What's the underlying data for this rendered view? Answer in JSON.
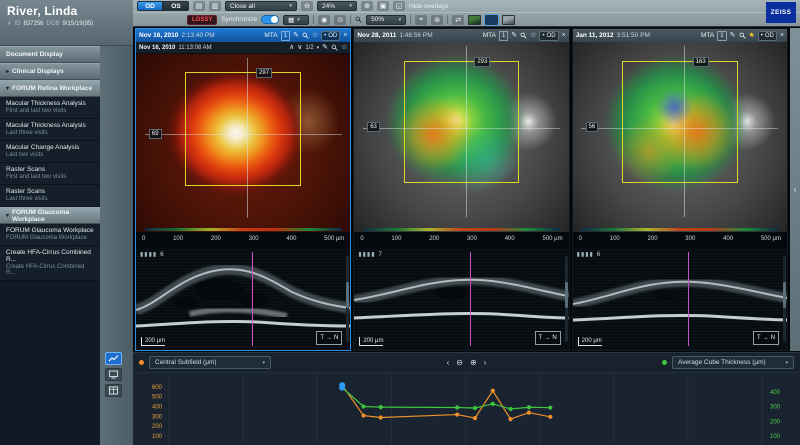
{
  "icons": {
    "pencil": "✎",
    "star": "☆",
    "star_filled": "★",
    "close": "×",
    "bullet": "•",
    "caret": "▾",
    "caret_right": "▸",
    "up": "∧",
    "down": "∨",
    "back": "‹",
    "forward": "›",
    "zoom_out": "⊖",
    "zoom_in": "⊕",
    "grid": "▦",
    "print": "▤",
    "export": "▥",
    "frame": "▣",
    "corner": "◱",
    "target": "⌖",
    "circle": "◉",
    "ring": "⊚",
    "dot_op": "⊙",
    "swap": "⇄",
    "female": "♀",
    "collapse": "‹",
    "slider": "▮▮▮▮",
    "arrow_right": "→"
  },
  "patient": {
    "name": "River, Linda",
    "sex_symbol": "♀",
    "id_label": "ID",
    "id": "837256",
    "dob_label": "DOB",
    "dob": "9/15/19(95)"
  },
  "sidebar": {
    "items": [
      {
        "label": "Document Display"
      },
      {
        "label": "Clinical Displays"
      },
      {
        "label": "FORUM Retina Workplace"
      },
      {
        "label": "Macular Thickness Analysis",
        "sub": "First and last two visits"
      },
      {
        "label": "Macular Thickness Analysis",
        "sub": "Last three visits"
      },
      {
        "label": "Macular Change Analysis",
        "sub": "Last two visits"
      },
      {
        "label": "Raster Scans",
        "sub": "First and last two visits"
      },
      {
        "label": "Raster Scans",
        "sub": "Last three visits"
      },
      {
        "label": "FORUM Glaucoma Workplace"
      },
      {
        "label": "FORUM Glaucoma Workplace",
        "sub": "FORUM Glaucoma Workplace"
      },
      {
        "label": "Create HFA-Cirrus Combined R...",
        "sub": "Create HFA-Cirrus Combined R..."
      }
    ]
  },
  "toolbar": {
    "od": "OD",
    "os": "OS",
    "close_all": "Close all",
    "zoom_level": "24%",
    "hide_overlays": "Hide overlays",
    "lossy": "LOSSY",
    "synchronize": "Synchronize",
    "zoom_level_2": "50%",
    "logo": "ZEISS"
  },
  "panels": [
    {
      "date": "Nov 16, 2010",
      "time": "2:13:40 PM",
      "modality": "MTA",
      "count": "1",
      "eye": "OD",
      "sub": {
        "date": "Nov 16, 2010",
        "time": "11:13:08 AM",
        "page": "1/2"
      },
      "fundus": {
        "label_top": "297",
        "label_left": "69"
      },
      "ruler": [
        "0",
        "100",
        "200",
        "300",
        "400",
        "500 μm"
      ],
      "oct": {
        "slice": "6",
        "scale": "200 μm",
        "dir_left": "T",
        "dir_right": "N"
      }
    },
    {
      "date": "Nov 28, 2011",
      "time": "1:48:56 PM",
      "modality": "MTA",
      "count": "1",
      "eye": "OD",
      "fundus": {
        "label_top": "293",
        "label_left": "63"
      },
      "ruler": [
        "0",
        "100",
        "200",
        "300",
        "400",
        "500 μm"
      ],
      "oct": {
        "slice": "7",
        "scale": "200 μm",
        "dir_left": "T",
        "dir_right": "N"
      }
    },
    {
      "date": "Jan 11, 2012",
      "time": "3:51:50 PM",
      "modality": "MTA",
      "count": "1",
      "eye": "OD",
      "fundus": {
        "label_top": "163",
        "label_left": "56"
      },
      "ruler": [
        "0",
        "100",
        "200",
        "300",
        "400",
        "500 μm"
      ],
      "oct": {
        "slice": "6",
        "scale": "200 μm",
        "dir_left": "T",
        "dir_right": "N"
      }
    }
  ],
  "chart": {
    "left_series_label": "Central Subfield (μm)",
    "right_series_label": "Average Cube Thickness (μm)",
    "left_dot_color": "#ef8f2b",
    "right_dot_color": "#3ec43e"
  },
  "chart_data": {
    "type": "line",
    "x_frac": [
      0.292,
      0.328,
      0.357,
      0.486,
      0.516,
      0.546,
      0.576,
      0.607,
      0.643
    ],
    "highlight_index": 0,
    "highlight_color": "#2b9df4",
    "series": [
      {
        "name": "Central Subfield (μm)",
        "axis": "left",
        "color": "#ef8f2b",
        "values": [
          618,
          308,
          288,
          318,
          282,
          560,
          272,
          338,
          295
        ]
      },
      {
        "name": "Average Cube Thickness (μm)",
        "axis": "right",
        "color": "#3ec43e",
        "values": [
          428,
          300,
          296,
          293,
          290,
          318,
          283,
          295,
          292
        ]
      }
    ],
    "left_axis": {
      "color": "#e8a23c",
      "range": [
        100,
        700
      ],
      "ticks": [
        600,
        500,
        400,
        300,
        200,
        100
      ]
    },
    "right_axis": {
      "color": "#4fd04f",
      "range": [
        100,
        500
      ],
      "ticks": [
        400,
        300,
        200,
        100
      ]
    },
    "grid": "vertical",
    "legend_position": "header",
    "x_tick_labels": []
  }
}
